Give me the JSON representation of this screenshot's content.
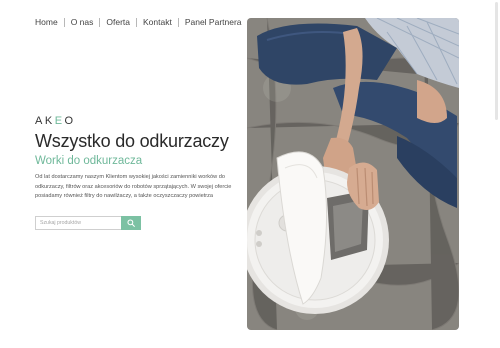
{
  "nav": {
    "items": [
      {
        "label": "Home"
      },
      {
        "label": "O nas"
      },
      {
        "label": "Oferta"
      },
      {
        "label": "Kontakt"
      },
      {
        "label": "Panel Partnera"
      }
    ]
  },
  "brand": {
    "logo_prefix": "AK",
    "logo_mark": "E",
    "logo_suffix": "O"
  },
  "hero": {
    "title": "Wszystko do odkurzaczy",
    "subtitle": "Worki do odkurzacza",
    "description": "Od lat dostarczamy naszym Klientom wysokiej jakości zamienniki worków do odkurzaczy, filtrów oraz akcesoriów do robotów sprzątających. W swojej ofercie posiadamy również filtry do nawilżaczy, a także oczyszczaczy powietrza"
  },
  "search": {
    "placeholder": "Szukaj produktów",
    "icon": "search-icon"
  },
  "colors": {
    "accent": "#7cc1a3",
    "accent_text": "#6fb89a"
  }
}
